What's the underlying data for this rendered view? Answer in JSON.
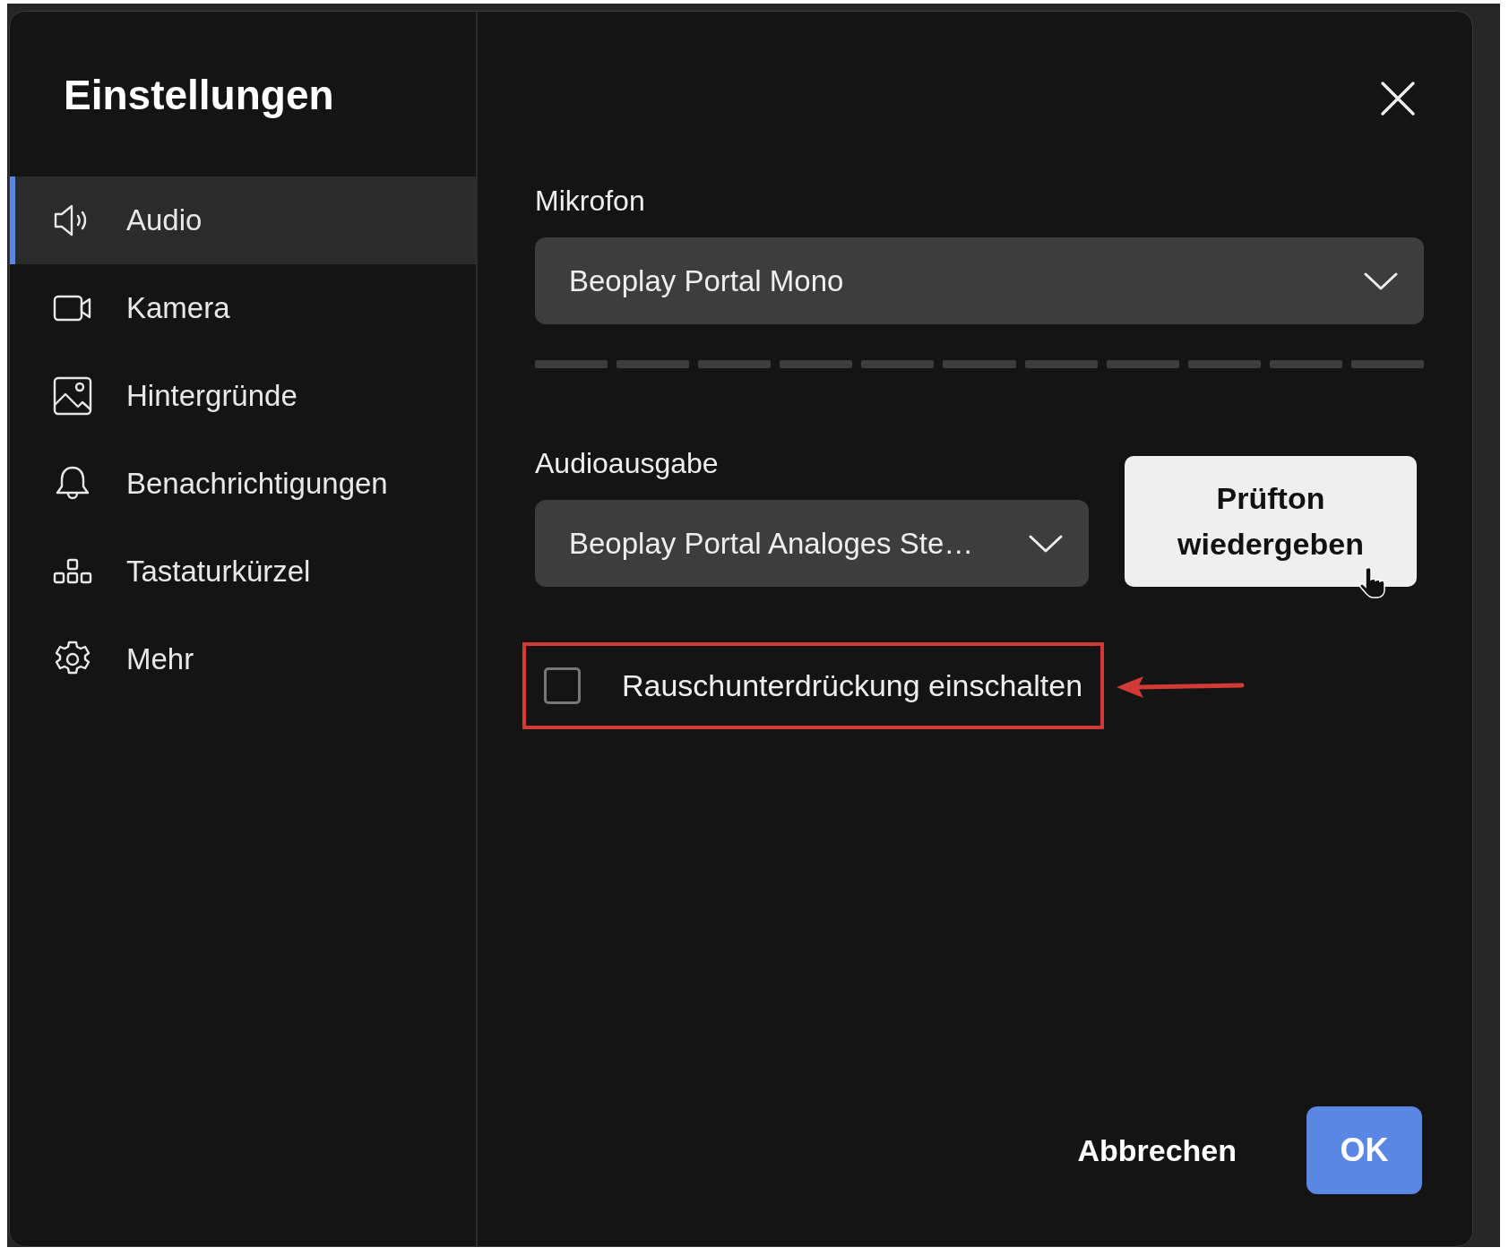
{
  "dialog": {
    "title": "Einstellungen"
  },
  "nav": [
    {
      "label": "Audio",
      "selected": true
    },
    {
      "label": "Kamera",
      "selected": false
    },
    {
      "label": "Hintergründe",
      "selected": false
    },
    {
      "label": "Benachrichtigungen",
      "selected": false
    },
    {
      "label": "Tastaturkürzel",
      "selected": false
    },
    {
      "label": "Mehr",
      "selected": false
    }
  ],
  "microphone": {
    "label": "Mikrofon",
    "value": "Beoplay Portal Mono"
  },
  "output": {
    "label": "Audioausgabe",
    "value": "Beoplay Portal Analoges Ste…",
    "test_button": "Prüfton wiedergeben"
  },
  "noise_suppression": {
    "label": "Rauschunterdrückung einschalten",
    "checked": false
  },
  "buttons": {
    "cancel": "Abbrechen",
    "ok": "OK"
  }
}
